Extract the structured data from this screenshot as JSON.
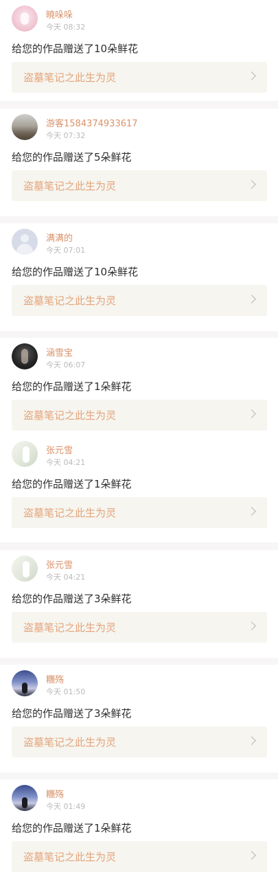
{
  "notifications": [
    {
      "username": "曉哚哚",
      "time": "今天 08:32",
      "message": "给您的作品赠送了10朵鲜花",
      "work_title": "盗墓笔记之此生为灵",
      "avatar": "pink-portrait-avatar"
    },
    {
      "username": "游客1584374933617",
      "time": "今天 07:32",
      "message": "给您的作品赠送了5朵鲜花",
      "work_title": "盗墓笔记之此生为灵",
      "avatar": "landscape-avatar"
    },
    {
      "username": "满满的",
      "time": "今天 07:01",
      "message": "给您的作品赠送了10朵鲜花",
      "work_title": "盗墓笔记之此生为灵",
      "avatar": "default-avatar"
    },
    {
      "username": "涵雪宝",
      "time": "今天 06:07",
      "message": "给您的作品赠送了1朵鲜花",
      "work_title": "盗墓笔记之此生为灵",
      "avatar": "dark-portrait-avatar"
    },
    {
      "username": "张元雪",
      "time": "今天 04:21",
      "message": "给您的作品赠送了1朵鲜花",
      "work_title": "盗墓笔记之此生为灵",
      "avatar": "light-portrait-avatar"
    },
    {
      "username": "张元雪",
      "time": "今天 04:21",
      "message": "给您的作品赠送了3朵鲜花",
      "work_title": "盗墓笔记之此生为灵",
      "avatar": "light-portrait-avatar"
    },
    {
      "username": "糰殇",
      "time": "今天 01:50",
      "message": "给您的作品赠送了3朵鲜花",
      "work_title": "盗墓笔记之此生为灵",
      "avatar": "sky-avatar"
    },
    {
      "username": "糰殇",
      "time": "今天 01:49",
      "message": "给您的作品赠送了1朵鲜花",
      "work_title": "盗墓笔记之此生为灵",
      "avatar": "sky-avatar"
    }
  ],
  "colors": {
    "username": "#d9926a",
    "work_title": "#e4a47c",
    "card_background": "#f6f5ef",
    "separator": "#f7f5f5"
  }
}
